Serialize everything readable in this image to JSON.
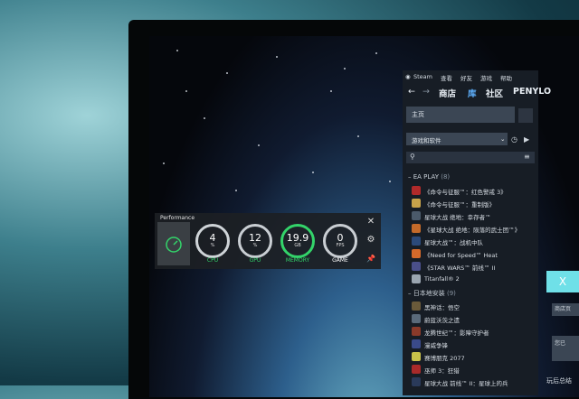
{
  "performance": {
    "title": "Performance",
    "gauges": [
      {
        "value": "4",
        "unit": "%",
        "label": "CPU",
        "color": "#33d46a"
      },
      {
        "value": "12",
        "unit": "%",
        "label": "GPU",
        "color": "#33d46a"
      },
      {
        "value": "19.9",
        "unit": "GB",
        "label": "MEMORY",
        "color": "#33d46a"
      },
      {
        "value": "0",
        "unit": "FPS",
        "label": "GAME",
        "color": "#ffffff"
      }
    ]
  },
  "steam": {
    "menu": [
      "Steam",
      "查看",
      "好友",
      "游戏",
      "帮助"
    ],
    "nav": [
      "商店",
      "库",
      "社区",
      "PENYLO"
    ],
    "home_label": "主页",
    "filter_label": "游戏和软件",
    "sections": [
      {
        "name": "EA PLAY",
        "count": "(8)"
      },
      {
        "name": "日本地安装",
        "count": "(9)"
      }
    ],
    "ea_games": [
      "《命令与征服™：红色警戒 3》",
      "《命令与征服™：重制版》",
      "星球大战 绝地：幸存者™",
      "《星球大战 绝地：陨落的武士团™》",
      "星球大战™：战机中队",
      "《Need for Speed™ Heat",
      "《STAR WARS™ 前线™ II",
      "Titanfall® 2"
    ],
    "local_games": [
      "黑神话：悟空",
      "蔚蓝沃茨之遗",
      "龙腾世纪™：影障守护者",
      "漫威争锋",
      "赛博朋克 2077",
      "巫师 3：狂猎",
      "星球大战 前线™ II：星球上的兵"
    ]
  },
  "right_panel": {
    "close": "X",
    "btn1": "商店页",
    "btn2": "您已",
    "footer": "玩后总结"
  },
  "colors": {
    "accent": "#5fb2ff",
    "gauge_green": "#33d46a",
    "teal": "#6fe0e8"
  }
}
